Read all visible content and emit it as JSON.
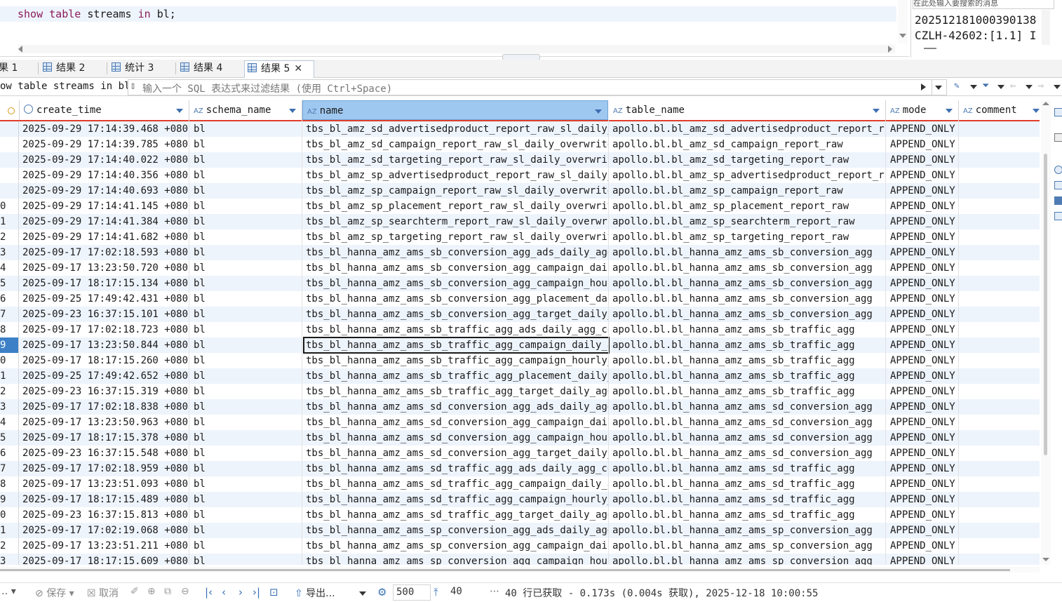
{
  "editor": {
    "sql_kw1": "show",
    "sql_kw2": "table",
    "sql_mid": "streams",
    "sql_kw3": "in",
    "sql_tail": "bl;"
  },
  "right_panel": {
    "search_placeholder": "在此处输入要搜索的消息",
    "line1": "20251218100039013​8",
    "line2": "CZLH-42602:[1.1] I"
  },
  "tabs": [
    {
      "label": "果 1",
      "icon": ""
    },
    {
      "label": "结果 2",
      "icon": "grid-icon"
    },
    {
      "label": "统计 3",
      "icon": "grid-icon"
    },
    {
      "label": "结果 4",
      "icon": "grid-icon"
    },
    {
      "label": "结果 5",
      "icon": "grid-icon",
      "active": true
    }
  ],
  "filter": {
    "query": "ow table streams in bl",
    "placeholder": "输入一个 SQL 表达式来过滤结果 (使用 Ctrl+Space)"
  },
  "columns": [
    {
      "key": "create_time",
      "label": "create_time",
      "icon": "clock-icon"
    },
    {
      "key": "schema_name",
      "label": "schema_name",
      "icon": "az-icon"
    },
    {
      "key": "name",
      "label": "name",
      "icon": "az-icon",
      "selected": true
    },
    {
      "key": "table_name",
      "label": "table_name",
      "icon": "az-icon"
    },
    {
      "key": "mode",
      "label": "mode",
      "icon": "az-icon"
    },
    {
      "key": "comment",
      "label": "comment",
      "icon": "az-icon"
    }
  ],
  "rows": [
    {
      "n": "",
      "create_time": "2025-09-29 17:14:39.468 +0800",
      "schema_name": "bl",
      "name": "tbs_bl_amz_sd_advertisedproduct_report_raw_sl_daily_ov",
      "table_name": "apollo.bl.bl_amz_sd_advertisedproduct_report_raw",
      "mode": "APPEND_ONLY",
      "comment": ""
    },
    {
      "n": "",
      "create_time": "2025-09-29 17:14:39.785 +0800",
      "schema_name": "bl",
      "name": "tbs_bl_amz_sd_campaign_report_raw_sl_daily_overwrite_c",
      "table_name": "apollo.bl.bl_amz_sd_campaign_report_raw",
      "mode": "APPEND_ONLY",
      "comment": ""
    },
    {
      "n": "",
      "create_time": "2025-09-29 17:14:40.022 +0800",
      "schema_name": "bl",
      "name": "tbs_bl_amz_sd_targeting_report_raw_sl_daily_overwrite_",
      "table_name": "apollo.bl.bl_amz_sd_targeting_report_raw",
      "mode": "APPEND_ONLY",
      "comment": ""
    },
    {
      "n": "",
      "create_time": "2025-09-29 17:14:40.356 +0800",
      "schema_name": "bl",
      "name": "tbs_bl_amz_sp_advertisedproduct_report_raw_sl_daily_ov",
      "table_name": "apollo.bl.bl_amz_sp_advertisedproduct_report_raw",
      "mode": "APPEND_ONLY",
      "comment": ""
    },
    {
      "n": "",
      "create_time": "2025-09-29 17:14:40.693 +0800",
      "schema_name": "bl",
      "name": "tbs_bl_amz_sp_campaign_report_raw_sl_daily_overwrite_c",
      "table_name": "apollo.bl.bl_amz_sp_campaign_report_raw",
      "mode": "APPEND_ONLY",
      "comment": ""
    },
    {
      "n": "0",
      "create_time": "2025-09-29 17:14:41.145 +0800",
      "schema_name": "bl",
      "name": "tbs_bl_amz_sp_placement_report_raw_sl_daily_overwrite_",
      "table_name": "apollo.bl.bl_amz_sp_placement_report_raw",
      "mode": "APPEND_ONLY",
      "comment": ""
    },
    {
      "n": "1",
      "create_time": "2025-09-29 17:14:41.384 +0800",
      "schema_name": "bl",
      "name": "tbs_bl_amz_sp_searchterm_report_raw_sl_daily_overwrite",
      "table_name": "apollo.bl.bl_amz_sp_searchterm_report_raw",
      "mode": "APPEND_ONLY",
      "comment": ""
    },
    {
      "n": "2",
      "create_time": "2025-09-29 17:14:41.682 +0800",
      "schema_name": "bl",
      "name": "tbs_bl_amz_sp_targeting_report_raw_sl_daily_overwrite_",
      "table_name": "apollo.bl.bl_amz_sp_targeting_report_raw",
      "mode": "APPEND_ONLY",
      "comment": ""
    },
    {
      "n": "3",
      "create_time": "2025-09-17 17:02:18.593 +0800",
      "schema_name": "bl",
      "name": "tbs_bl_hanna_amz_ams_sb_conversion_agg_ads_daily_agg_c",
      "table_name": "apollo.bl.bl_hanna_amz_ams_sb_conversion_agg",
      "mode": "APPEND_ONLY",
      "comment": ""
    },
    {
      "n": "4",
      "create_time": "2025-09-17 13:23:50.720 +0800",
      "schema_name": "bl",
      "name": "tbs_bl_hanna_amz_ams_sb_conversion_agg_campaign_daily_",
      "table_name": "apollo.bl.bl_hanna_amz_ams_sb_conversion_agg",
      "mode": "APPEND_ONLY",
      "comment": ""
    },
    {
      "n": "5",
      "create_time": "2025-09-17 18:17:15.134 +0800",
      "schema_name": "bl",
      "name": "tbs_bl_hanna_amz_ams_sb_conversion_agg_campaign_hourly",
      "table_name": "apollo.bl.bl_hanna_amz_ams_sb_conversion_agg",
      "mode": "APPEND_ONLY",
      "comment": ""
    },
    {
      "n": "6",
      "create_time": "2025-09-25 17:49:42.431 +0800",
      "schema_name": "bl",
      "name": "tbs_bl_hanna_amz_ams_sb_conversion_agg_placement_daily",
      "table_name": "apollo.bl.bl_hanna_amz_ams_sb_conversion_agg",
      "mode": "APPEND_ONLY",
      "comment": ""
    },
    {
      "n": "7",
      "create_time": "2025-09-23 16:37:15.101 +0800",
      "schema_name": "bl",
      "name": "tbs_bl_hanna_amz_ams_sb_conversion_agg_target_daily_ag",
      "table_name": "apollo.bl.bl_hanna_amz_ams_sb_conversion_agg",
      "mode": "APPEND_ONLY",
      "comment": ""
    },
    {
      "n": "8",
      "create_time": "2025-09-17 17:02:18.723 +0800",
      "schema_name": "bl",
      "name": "tbs_bl_hanna_amz_ams_sb_traffic_agg_ads_daily_agg_cons",
      "table_name": "apollo.bl.bl_hanna_amz_ams_sb_traffic_agg",
      "mode": "APPEND_ONLY",
      "comment": ""
    },
    {
      "n": "9",
      "create_time": "2025-09-17 13:23:50.844 +0800",
      "schema_name": "bl",
      "name": "tbs_bl_hanna_amz_ams_sb_traffic_agg_campaign_daily_agg",
      "table_name": "apollo.bl.bl_hanna_amz_ams_sb_traffic_agg",
      "mode": "APPEND_ONLY",
      "comment": "",
      "focused": true
    },
    {
      "n": "0",
      "create_time": "2025-09-17 18:17:15.260 +0800",
      "schema_name": "bl",
      "name": "tbs_bl_hanna_amz_ams_sb_traffic_agg_campaign_hourly_ag",
      "table_name": "apollo.bl.bl_hanna_amz_ams_sb_traffic_agg",
      "mode": "APPEND_ONLY",
      "comment": ""
    },
    {
      "n": "1",
      "create_time": "2025-09-25 17:49:42.652 +0800",
      "schema_name": "bl",
      "name": "tbs_bl_hanna_amz_ams_sb_traffic_agg_placement_daily_ag",
      "table_name": "apollo.bl.bl_hanna_amz_ams_sb_traffic_agg",
      "mode": "APPEND_ONLY",
      "comment": ""
    },
    {
      "n": "2",
      "create_time": "2025-09-23 16:37:15.319 +0800",
      "schema_name": "bl",
      "name": "tbs_bl_hanna_amz_ams_sb_traffic_agg_target_daily_agg_c",
      "table_name": "apollo.bl.bl_hanna_amz_ams_sb_traffic_agg",
      "mode": "APPEND_ONLY",
      "comment": ""
    },
    {
      "n": "3",
      "create_time": "2025-09-17 17:02:18.838 +0800",
      "schema_name": "bl",
      "name": "tbs_bl_hanna_amz_ams_sd_conversion_agg_ads_daily_agg_c",
      "table_name": "apollo.bl.bl_hanna_amz_ams_sd_conversion_agg",
      "mode": "APPEND_ONLY",
      "comment": ""
    },
    {
      "n": "4",
      "create_time": "2025-09-17 13:23:50.963 +0800",
      "schema_name": "bl",
      "name": "tbs_bl_hanna_amz_ams_sd_conversion_agg_campaign_daily_",
      "table_name": "apollo.bl.bl_hanna_amz_ams_sd_conversion_agg",
      "mode": "APPEND_ONLY",
      "comment": ""
    },
    {
      "n": "5",
      "create_time": "2025-09-17 18:17:15.378 +0800",
      "schema_name": "bl",
      "name": "tbs_bl_hanna_amz_ams_sd_conversion_agg_campaign_hourly",
      "table_name": "apollo.bl.bl_hanna_amz_ams_sd_conversion_agg",
      "mode": "APPEND_ONLY",
      "comment": ""
    },
    {
      "n": "6",
      "create_time": "2025-09-23 16:37:15.548 +0800",
      "schema_name": "bl",
      "name": "tbs_bl_hanna_amz_ams_sd_conversion_agg_target_daily_ag",
      "table_name": "apollo.bl.bl_hanna_amz_ams_sd_conversion_agg",
      "mode": "APPEND_ONLY",
      "comment": ""
    },
    {
      "n": "7",
      "create_time": "2025-09-17 17:02:18.959 +0800",
      "schema_name": "bl",
      "name": "tbs_bl_hanna_amz_ams_sd_traffic_agg_ads_daily_agg_cons",
      "table_name": "apollo.bl.bl_hanna_amz_ams_sd_traffic_agg",
      "mode": "APPEND_ONLY",
      "comment": ""
    },
    {
      "n": "8",
      "create_time": "2025-09-17 13:23:51.093 +0800",
      "schema_name": "bl",
      "name": "tbs_bl_hanna_amz_ams_sd_traffic_agg_campaign_daily_agg",
      "table_name": "apollo.bl.bl_hanna_amz_ams_sd_traffic_agg",
      "mode": "APPEND_ONLY",
      "comment": ""
    },
    {
      "n": "9",
      "create_time": "2025-09-17 18:17:15.489 +0800",
      "schema_name": "bl",
      "name": "tbs_bl_hanna_amz_ams_sd_traffic_agg_campaign_hourly_ag",
      "table_name": "apollo.bl.bl_hanna_amz_ams_sd_traffic_agg",
      "mode": "APPEND_ONLY",
      "comment": ""
    },
    {
      "n": "0",
      "create_time": "2025-09-23 16:37:15.813 +0800",
      "schema_name": "bl",
      "name": "tbs_bl_hanna_amz_ams_sd_traffic_agg_target_daily_agg_c",
      "table_name": "apollo.bl.bl_hanna_amz_ams_sd_traffic_agg",
      "mode": "APPEND_ONLY",
      "comment": ""
    },
    {
      "n": "1",
      "create_time": "2025-09-17 17:02:19.068 +0800",
      "schema_name": "bl",
      "name": "tbs_bl_hanna_amz_ams_sp_conversion_agg_ads_daily_agg_c",
      "table_name": "apollo.bl.bl_hanna_amz_ams_sp_conversion_agg",
      "mode": "APPEND_ONLY",
      "comment": ""
    },
    {
      "n": "2",
      "create_time": "2025-09-17 13:23:51.211 +0800",
      "schema_name": "bl",
      "name": "tbs_bl_hanna_amz_ams_sp_conversion_agg_campaign_daily_",
      "table_name": "apollo.bl.bl_hanna_amz_ams_sp_conversion_agg",
      "mode": "APPEND_ONLY",
      "comment": ""
    },
    {
      "n": "3",
      "create_time": "2025-09-17 18:17:15.609 +0800",
      "schema_name": "bl",
      "name": "tbs_bl_hanna_amz_ams_sp_conversion_agg_campaign_hourly",
      "table_name": "apollo.bl.bl_hanna_amz_ams_sp_conversion_agg",
      "mode": "APPEND_ONLY",
      "comment": ""
    }
  ],
  "bottom": {
    "save_label": "保存",
    "cancel_label": "取消",
    "export_label": "导出...",
    "fetch_size": "500",
    "row_count": "40",
    "status": "40 行已获取 - 0.173s (0.004s 获取), 2025-12-18 10:00:55"
  },
  "colors": {
    "accent": "#3e6fb0",
    "header_underline": "#e23d2b",
    "selected_header": "#9fc8f0",
    "alt_row": "#eef4fc"
  }
}
